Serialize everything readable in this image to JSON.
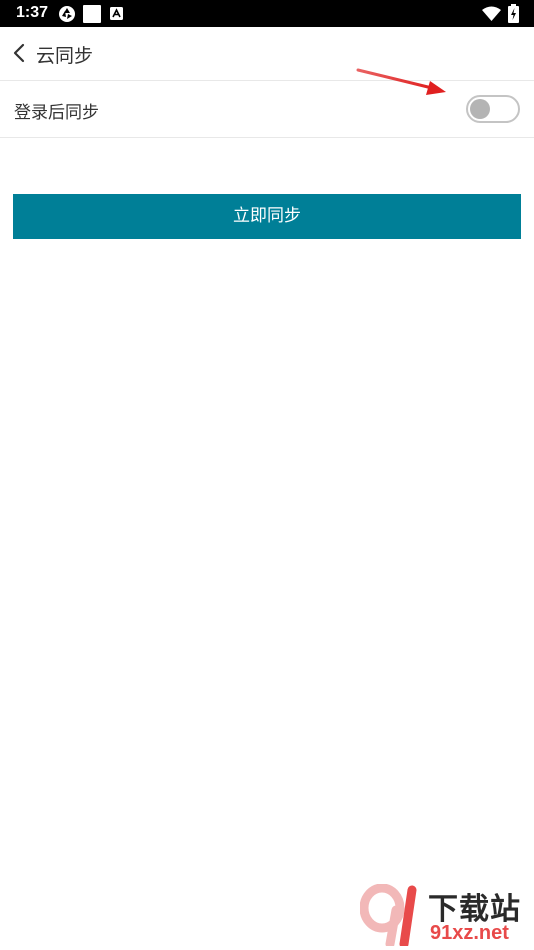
{
  "status_bar": {
    "time": "1:37",
    "icons": [
      "aperture-icon",
      "square-icon",
      "a-badge-icon",
      "wifi-icon",
      "battery-charging-icon"
    ]
  },
  "header": {
    "back_icon": "chevron-left-icon",
    "title": "云同步"
  },
  "settings": {
    "sync_after_login": {
      "label": "登录后同步",
      "enabled": false
    }
  },
  "actions": {
    "sync_now_label": "立即同步"
  },
  "watermark": {
    "brand": "下载站",
    "url": "91xz.net"
  },
  "colors": {
    "accent": "#007f97",
    "toggle_off_knob": "#b4b4b4",
    "annotation_arrow": "#e02020"
  }
}
